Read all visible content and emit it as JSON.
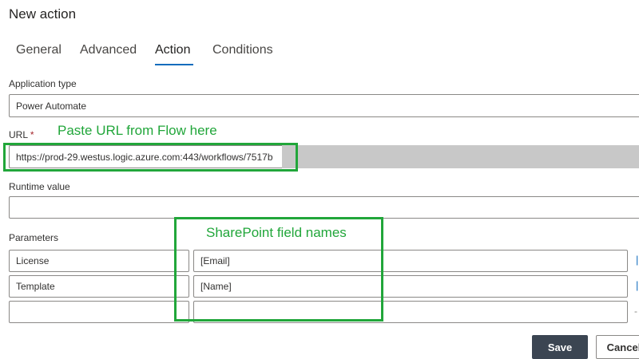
{
  "dialog": {
    "title": "New action"
  },
  "tabs": [
    {
      "label": "General"
    },
    {
      "label": "Advanced"
    },
    {
      "label": "Action"
    },
    {
      "label": "Conditions"
    }
  ],
  "form": {
    "application_type": {
      "label": "Application type",
      "value": "Power Automate"
    },
    "url": {
      "label": "URL",
      "required_mark": "*",
      "value": "https://prod-29.westus.logic.azure.com:443/workflows/7517b"
    },
    "runtime_value": {
      "label": "Runtime value",
      "value": ""
    },
    "parameters": {
      "label": "Parameters",
      "rows": [
        {
          "name": "License",
          "value": "[Email]"
        },
        {
          "name": "Template",
          "value": "[Name]"
        },
        {
          "name": "",
          "value": ""
        }
      ]
    }
  },
  "annotations": {
    "url_note": "Paste URL from Flow here",
    "params_note": "SharePoint field names"
  },
  "footer": {
    "save_label": "Save",
    "cancel_label": "Cancel"
  },
  "colors": {
    "annotation": "#21a63a",
    "accent": "#0f6cbd",
    "primary_button": "#3b4552"
  },
  "icons": {
    "row_edge": "link-icon"
  }
}
